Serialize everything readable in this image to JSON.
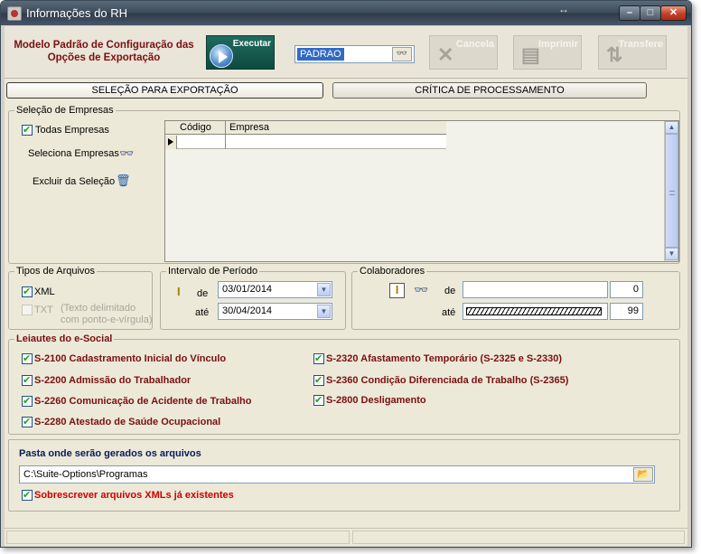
{
  "window": {
    "title": "Informações do RH"
  },
  "header": {
    "model_title": "Modelo Padrão de Configuração das Opções de Exportação",
    "execute_label": "Executar",
    "model_value": "PADRAO",
    "cancel_label": "Cancela",
    "print_label": "Imprimir",
    "transfer_label": "Transfere"
  },
  "tabs": [
    {
      "label": "SELEÇÃO PARA EXPORTAÇÃO",
      "active": true
    },
    {
      "label": "CRÍTICA DE PROCESSAMENTO",
      "active": false
    }
  ],
  "empresas": {
    "group_title": "Seleção de Empresas",
    "todas_label": "Todas Empresas",
    "todas_checked": true,
    "seleciona_label": "Seleciona Empresas",
    "excluir_label": "Excluir da Seleção",
    "columns": [
      "Código",
      "Empresa"
    ]
  },
  "tipos": {
    "group_title": "Tipos de Arquivos",
    "xml_label": "XML",
    "xml_checked": true,
    "txt_label": "TXT",
    "txt_note": "(Texto delimitado com ponto-e-vírgula)",
    "txt_checked": false
  },
  "periodo": {
    "group_title": "Intervalo de Período",
    "de_label": "de",
    "de_value": "03/01/2014",
    "ate_label": "até",
    "ate_value": "30/04/2014"
  },
  "colaboradores": {
    "group_title": "Colaboradores",
    "de_label": "de",
    "de_num": "0",
    "ate_label": "até",
    "ate_num": "99"
  },
  "leiautes": {
    "group_title": "Leiautes do e-Social",
    "items": [
      {
        "label": "S-2100 Cadastramento Inicial do Vínculo",
        "checked": true
      },
      {
        "label": "S-2200 Admissão do Trabalhador",
        "checked": true
      },
      {
        "label": "S-2260 Comunicação de Acidente de Trabalho",
        "checked": true
      },
      {
        "label": "S-2280 Atestado de Saúde Ocupacional",
        "checked": true
      },
      {
        "label": "S-2320 Afastamento Temporário (S-2325 e S-2330)",
        "checked": true
      },
      {
        "label": "S-2360 Condição Diferenciada de Trabalho (S-2365)",
        "checked": true
      },
      {
        "label": "S-2800 Desligamento",
        "checked": true
      }
    ]
  },
  "pasta": {
    "title": "Pasta onde serão gerados os arquivos",
    "path": "C:\\Suite-Options\\Programas",
    "overwrite_label": "Sobrescrever arquivos XMLs já existentes",
    "overwrite_checked": true
  },
  "colors": {
    "accent_dark_red": "#7a1010",
    "overwrite_red": "#cc0000",
    "selection_blue": "#316ac5",
    "check_green": "#21a121"
  }
}
